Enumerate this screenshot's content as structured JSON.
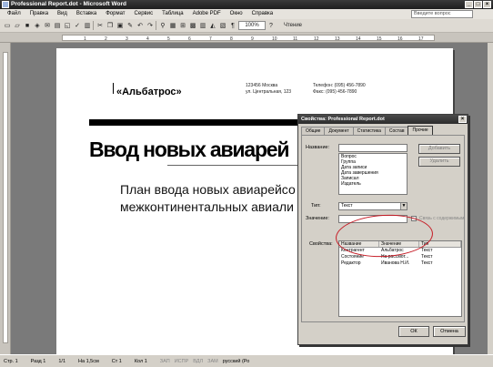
{
  "window": {
    "title": "Professional Report.dot - Microsoft Word",
    "buttons": [
      "_",
      "□",
      "×"
    ]
  },
  "menubar": {
    "items": [
      "Файл",
      "Правка",
      "Вид",
      "Вставка",
      "Формат",
      "Сервис",
      "Таблица",
      "Adobe PDF",
      "Окно",
      "Справка"
    ],
    "help_placeholder": "Введите вопрос"
  },
  "toolbar": {
    "zoom": "100%",
    "read_label": "Чтение"
  },
  "document": {
    "company": "«Альбатрос»",
    "address_left": "123456 Москва\nул. Центральная, 123",
    "address_right": "Телефон: (095) 456-7890\nФакс: (095) 456-7890",
    "heading": "Ввод новых авиарей",
    "body": "План ввода новых авиарейсо\nмежконтинентальных авиали"
  },
  "dialog": {
    "title": "Свойства: Professional Report.dot",
    "close": "×",
    "tabs": [
      "Общие",
      "Документ",
      "Статистика",
      "Состав",
      "Прочие"
    ],
    "active_tab": 4,
    "name_label": "Название:",
    "name_list": [
      "Вопрос",
      "Группа",
      "Дата записи",
      "Дата завершения",
      "Записал",
      "Издатель"
    ],
    "add_button": "Добавить",
    "delete_button": "Удалить",
    "type_label": "Тип:",
    "type_value": "Текст",
    "value_label": "Значение:",
    "link_label": "Связь с содержимым",
    "props_label": "Свойства:",
    "props_columns": [
      "Название",
      "Значение",
      "Тип"
    ],
    "props_rows": [
      [
        "Контрагент",
        "Альбатрос",
        "Текст"
      ],
      [
        "Состояние",
        "На рассмот...",
        "Текст"
      ],
      [
        "Редактор",
        "Иванова Н.И.",
        "Текст"
      ]
    ],
    "ok_button": "ОК",
    "cancel_button": "Отмена"
  },
  "status": {
    "page": "Стр. 1",
    "section": "Разд 1",
    "pages": "1/1",
    "position": "На 1,5см",
    "line": "Ст 1",
    "column": "Кол 1",
    "modes": [
      "ЗАП",
      "ИСПР",
      "ВДЛ",
      "ЗАМ"
    ],
    "language": "русский (Ро"
  },
  "colors": {
    "annotation_circle": "#c61b25"
  }
}
